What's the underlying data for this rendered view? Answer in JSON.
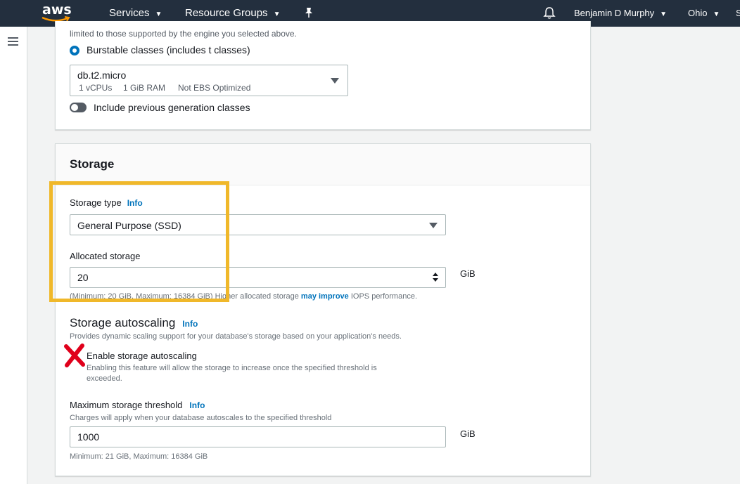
{
  "nav": {
    "logo": "aws",
    "services": "Services",
    "resource_groups": "Resource Groups",
    "user": "Benjamin D Murphy",
    "region": "Ohio",
    "cutoff": "S",
    "icons": [
      "pin-icon",
      "bell-icon",
      "chevron-down-icon"
    ]
  },
  "instance": {
    "cut_text": "limited to those supported by the engine you selected above.",
    "radio_label": "Burstable classes (includes t classes)",
    "class_value": "db.t2.micro",
    "class_vcpu": "1 vCPUs",
    "class_ram": "1 GiB RAM",
    "class_ebs": "Not EBS Optimized",
    "toggle_label": "Include previous generation classes"
  },
  "storage": {
    "title": "Storage",
    "type_label": "Storage type",
    "info": "Info",
    "type_value": "General Purpose (SSD)",
    "allocated_label": "Allocated storage",
    "allocated_value": "20",
    "unit": "GiB",
    "allocated_hint_pre": "(Minimum: 20 GiB, Maximum: 16384 GiB) Higher allocated storage",
    "allocated_hint_link": "may improve",
    "allocated_hint_post": "IOPS performance."
  },
  "autoscaling": {
    "title": "Storage autoscaling",
    "desc": "Provides dynamic scaling support for your database's storage based on your application's needs.",
    "checkbox_label": "Enable storage autoscaling",
    "checkbox_desc_1": "Enabling this feature will allow the storage to increase once the specified threshold is",
    "checkbox_desc_2": "exceeded.",
    "max_label": "Maximum storage threshold",
    "max_desc": "Charges will apply when your database autoscales to the specified threshold",
    "max_value": "1000",
    "max_hint": "Minimum: 21 GiB, Maximum: 16384 GiB"
  },
  "colors": {
    "nav_bg": "#232f3e",
    "link": "#0073bb",
    "highlight": "#f0b82a",
    "red_x": "#e0001b"
  }
}
